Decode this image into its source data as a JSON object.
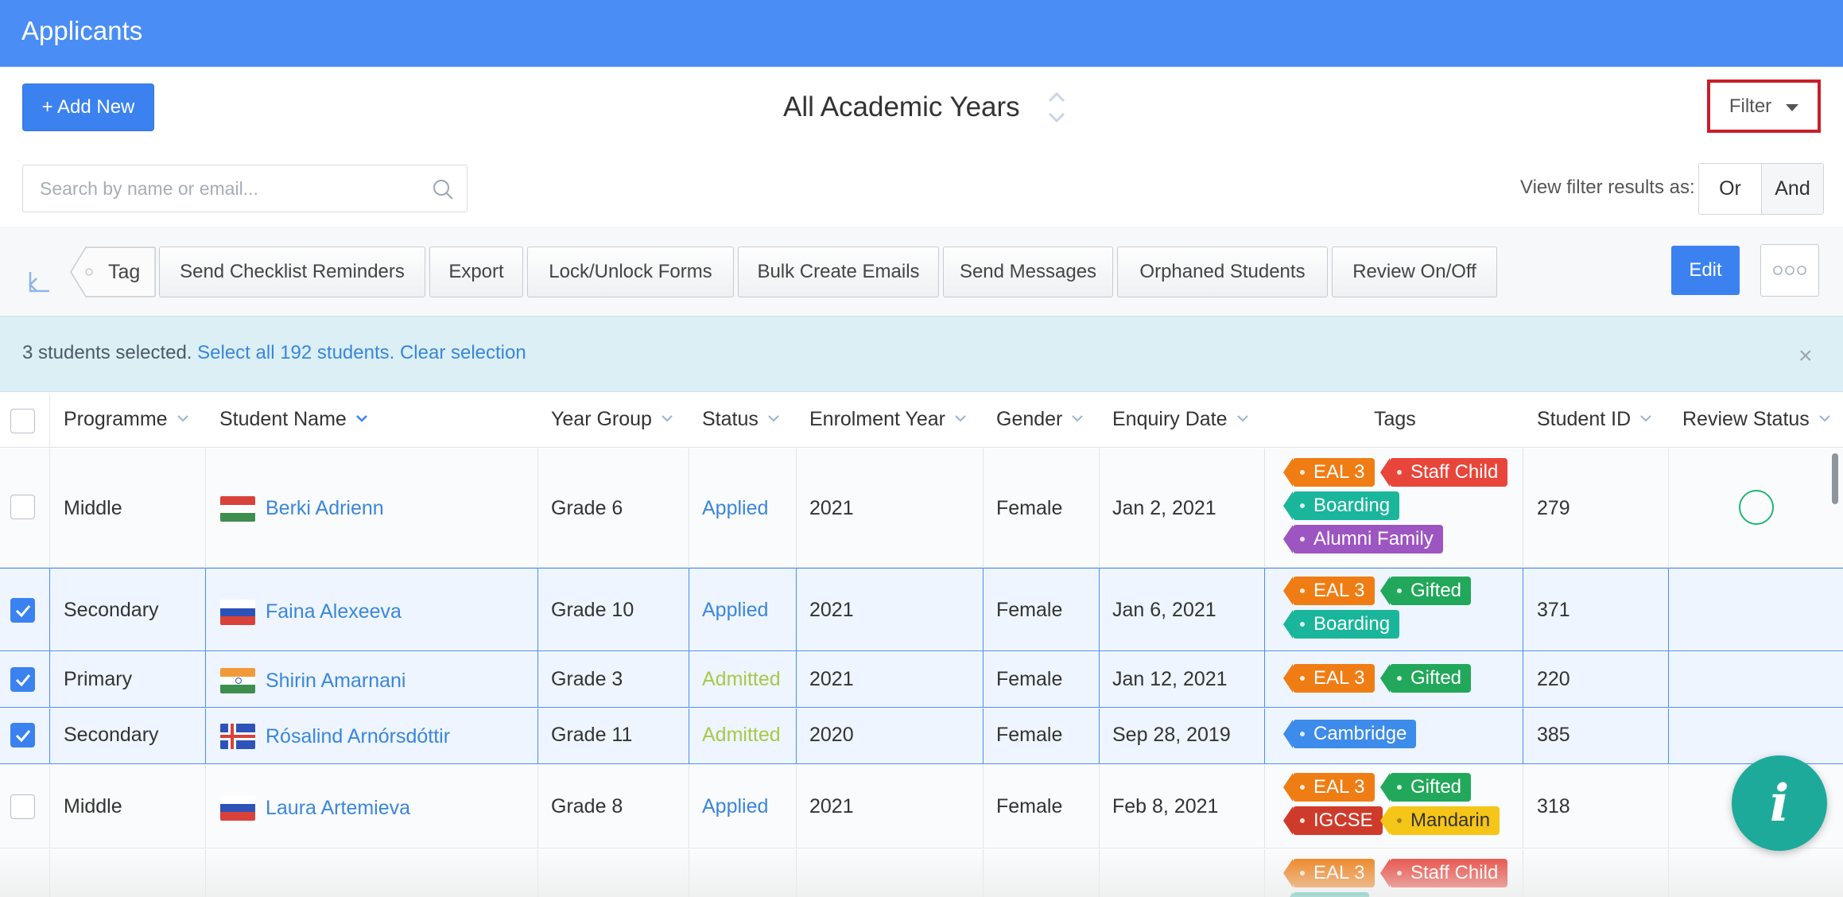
{
  "header": {
    "title": "Applicants"
  },
  "actions": {
    "add_new": "+ Add New",
    "filter": "Filter"
  },
  "year_selector": {
    "label": "All Academic Years"
  },
  "search": {
    "placeholder": "Search by name or email..."
  },
  "view_filter": {
    "label": "View filter results as:",
    "or": "Or",
    "and": "And"
  },
  "toolbar": {
    "tag": "Tag",
    "buttons": [
      "Send Checklist Reminders",
      "Export",
      "Lock/Unlock Forms",
      "Bulk Create Emails",
      "Send Messages",
      "Orphaned Students",
      "Review On/Off"
    ],
    "edit": "Edit"
  },
  "selection": {
    "count_text": "3 students selected.",
    "select_all": "Select all 192 students.",
    "clear": "Clear selection",
    "close": "×"
  },
  "table": {
    "columns": [
      "Programme",
      "Student Name",
      "Year Group",
      "Status",
      "Enrolment Year",
      "Gender",
      "Enquiry Date",
      "Tags",
      "Student ID",
      "Review Status"
    ],
    "rows": [
      {
        "programme": "Middle",
        "name": "Berki Adrienn",
        "flag": "hungary",
        "year_group": "Grade 6",
        "status": "Applied",
        "enrolment_year": "2021",
        "gender": "Female",
        "enquiry_date": "Jan 2, 2021",
        "tags": [
          "EAL 3",
          "Staff Child",
          "Boarding",
          "Alumni Family"
        ],
        "student_id": "279",
        "selected": false
      },
      {
        "programme": "Secondary",
        "name": "Faina Alexeeva",
        "flag": "russia",
        "year_group": "Grade 10",
        "status": "Applied",
        "enrolment_year": "2021",
        "gender": "Female",
        "enquiry_date": "Jan 6, 2021",
        "tags": [
          "EAL 3",
          "Gifted",
          "Boarding"
        ],
        "student_id": "371",
        "selected": true
      },
      {
        "programme": "Primary",
        "name": "Shirin Amarnani",
        "flag": "india",
        "year_group": "Grade 3",
        "status": "Admitted",
        "enrolment_year": "2021",
        "gender": "Female",
        "enquiry_date": "Jan 12, 2021",
        "tags": [
          "EAL 3",
          "Gifted"
        ],
        "student_id": "220",
        "selected": true
      },
      {
        "programme": "Secondary",
        "name": "Rósalind Arnórsdóttir",
        "flag": "iceland",
        "year_group": "Grade 11",
        "status": "Admitted",
        "enrolment_year": "2020",
        "gender": "Female",
        "enquiry_date": "Sep 28, 2019",
        "tags": [
          "Cambridge"
        ],
        "student_id": "385",
        "selected": true
      },
      {
        "programme": "Middle",
        "name": "Laura Artemieva",
        "flag": "russia",
        "year_group": "Grade 8",
        "status": "Applied",
        "enrolment_year": "2021",
        "gender": "Female",
        "enquiry_date": "Feb 8, 2021",
        "tags": [
          "EAL 3",
          "Gifted",
          "IGCSE",
          "Mandarin"
        ],
        "student_id": "318",
        "selected": false
      },
      {
        "programme": "",
        "name": "",
        "flag": "",
        "year_group": "",
        "status": "",
        "enrolment_year": "",
        "gender": "",
        "enquiry_date": "",
        "tags": [
          "EAL 3",
          "Staff Child"
        ],
        "student_id": "",
        "selected": false
      }
    ]
  },
  "colors": {
    "topbar": "#4a8ef5",
    "accent": "#3b82f0",
    "link": "#3a86dc",
    "admitted": "#a6c94a",
    "filter_highlight": "#c81e2a"
  },
  "fab": {
    "icon": "i"
  }
}
